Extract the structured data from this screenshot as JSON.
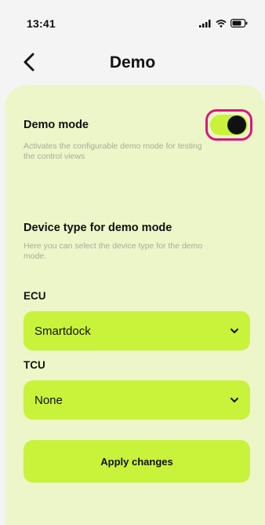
{
  "status_bar": {
    "time": "13:41",
    "icons": [
      "signal-icon",
      "wifi-icon",
      "battery-icon"
    ]
  },
  "header": {
    "title": "Demo",
    "back_icon": "chevron-left-icon"
  },
  "demo_mode": {
    "title": "Demo mode",
    "description": "Activates the configurable demo mode for testing the control views",
    "enabled": true,
    "highlight_color": "#d8197a"
  },
  "device_type": {
    "title": "Device type for demo mode",
    "description": "Here you can select the device type for the demo mode."
  },
  "ecu": {
    "label": "ECU",
    "value": "Smartdock"
  },
  "tcu": {
    "label": "TCU",
    "value": "None"
  },
  "apply_label": "Apply changes",
  "colors": {
    "accent": "#c9f23a",
    "panel": "#ecf6c9",
    "background": "#f4f4f4",
    "hint_text": "#a7ad98"
  }
}
